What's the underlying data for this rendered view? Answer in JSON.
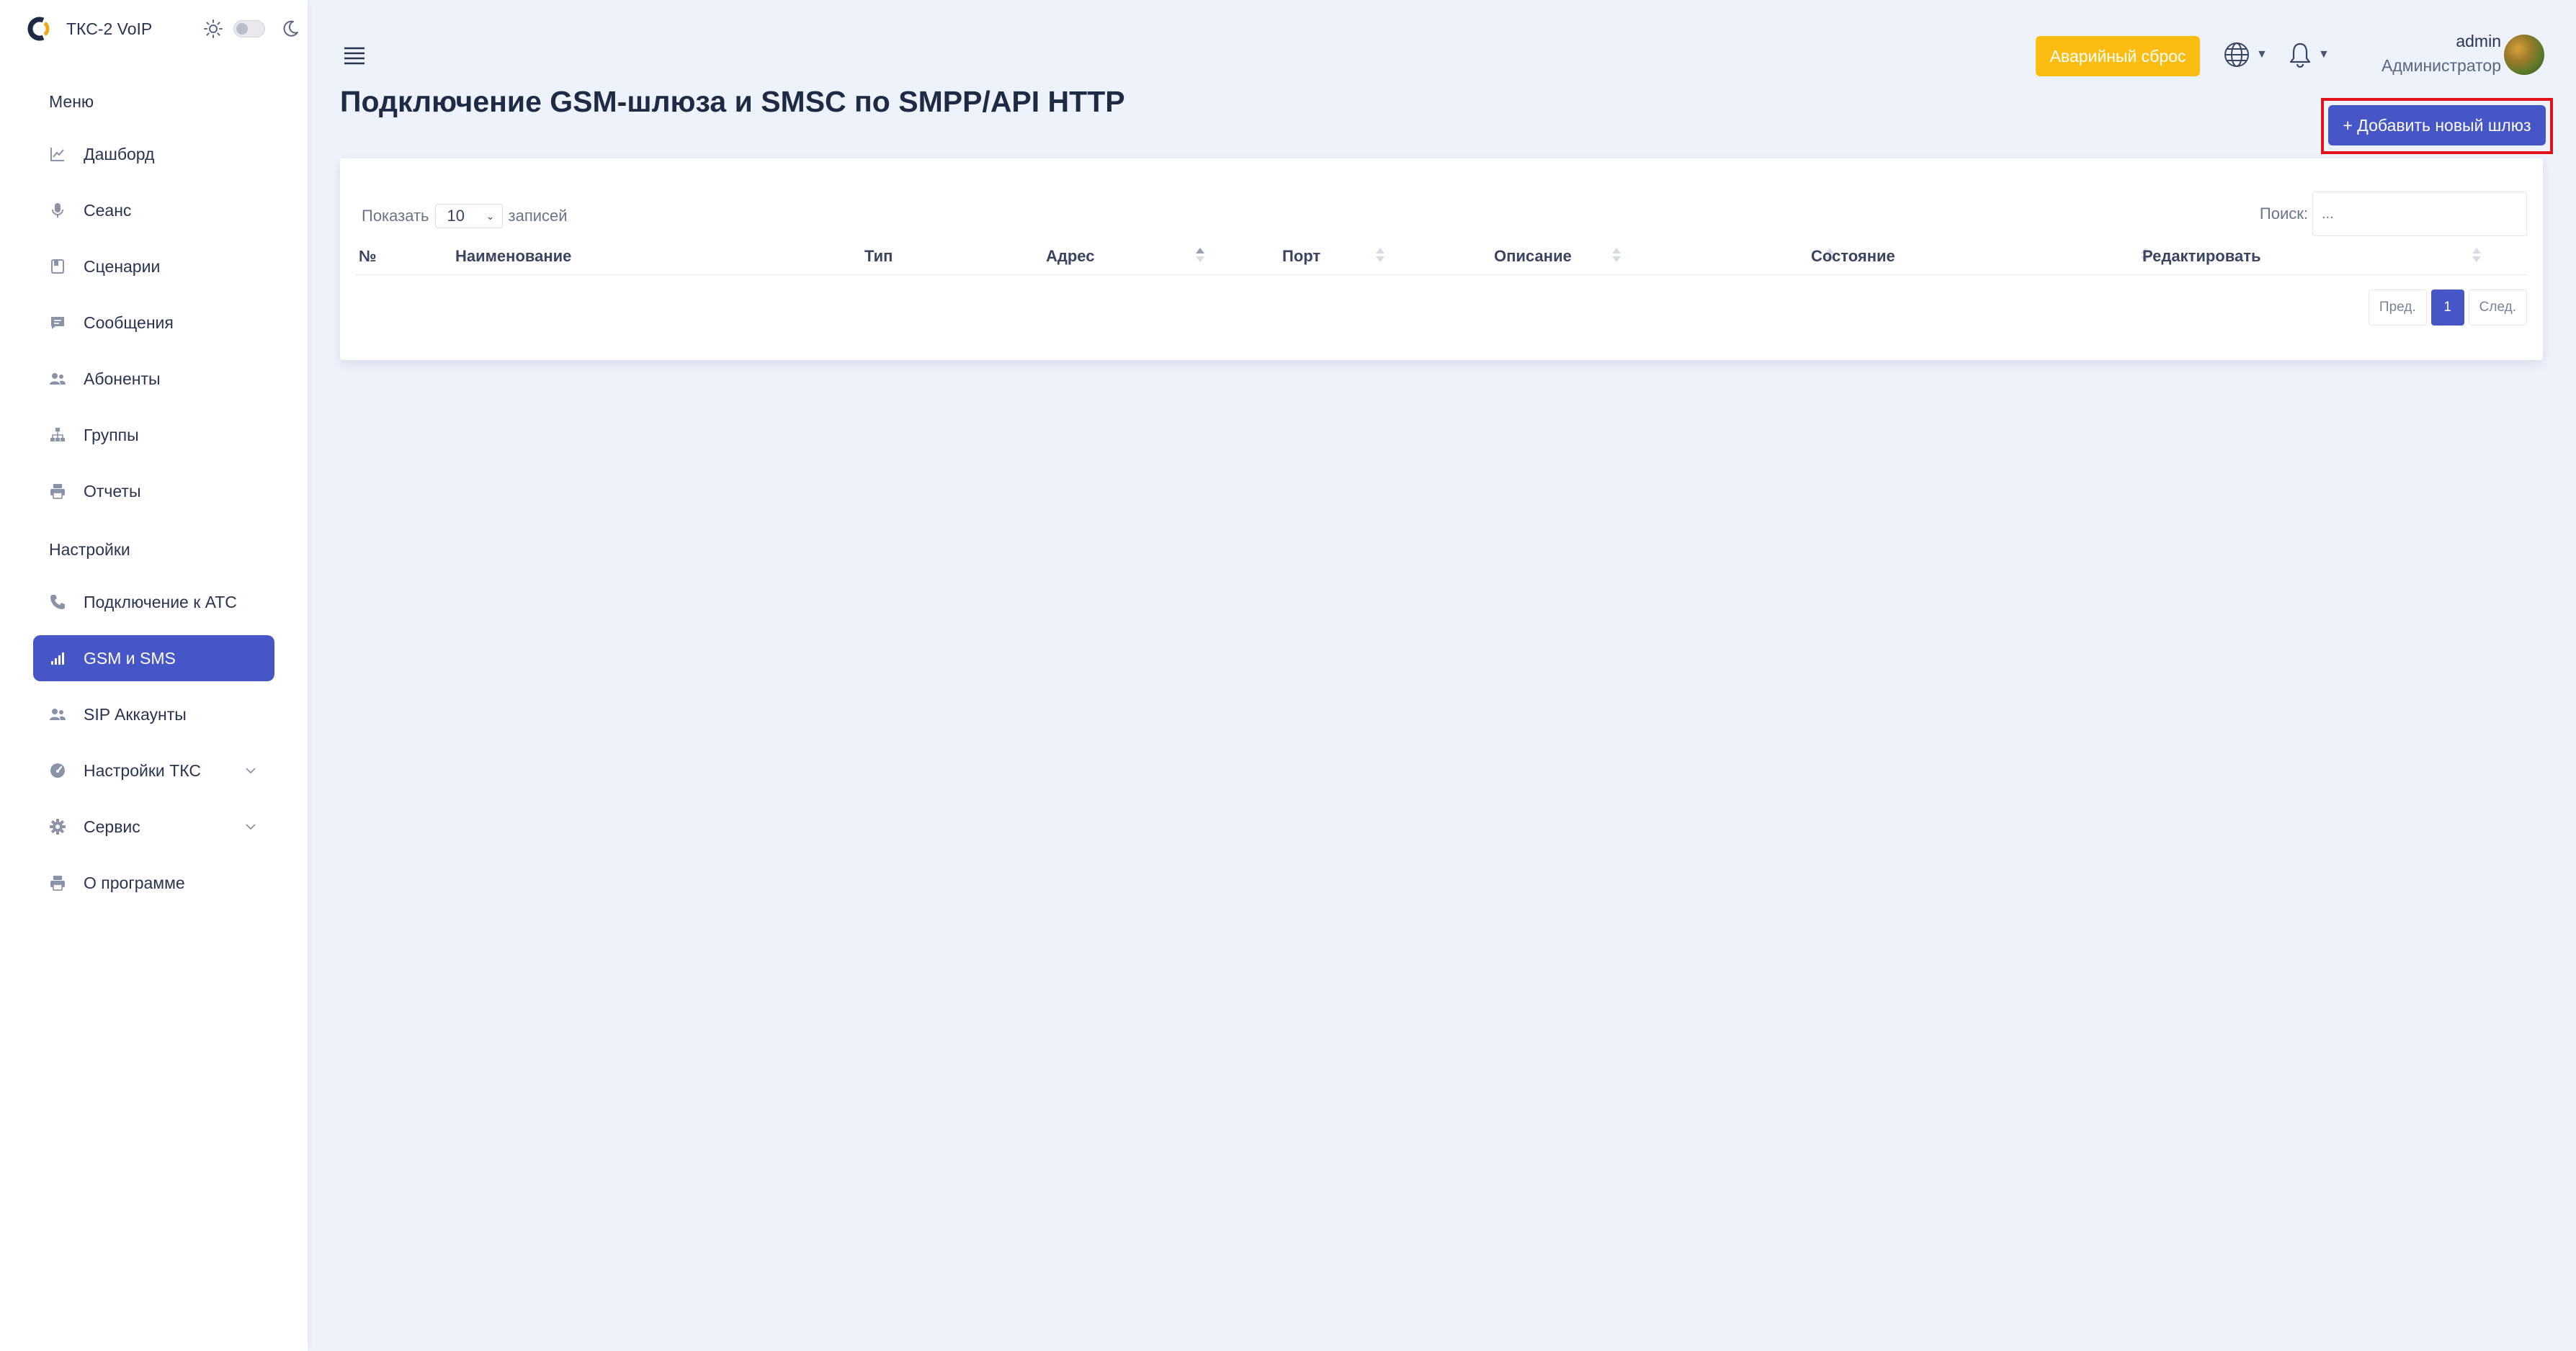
{
  "app": {
    "name": "ТКС-2 VoIP"
  },
  "sidebar": {
    "menu_title": "Меню",
    "menu": [
      {
        "label": "Дашборд",
        "icon": "chart-line-icon"
      },
      {
        "label": "Сеанс",
        "icon": "microphone-icon"
      },
      {
        "label": "Сценарии",
        "icon": "book-icon"
      },
      {
        "label": "Сообщения",
        "icon": "message-icon"
      },
      {
        "label": "Абоненты",
        "icon": "users-icon"
      },
      {
        "label": "Группы",
        "icon": "sitemap-icon"
      },
      {
        "label": "Отчеты",
        "icon": "printer-icon"
      }
    ],
    "settings_title": "Настройки",
    "settings": [
      {
        "label": "Подключение к АТС",
        "icon": "phone-icon"
      },
      {
        "label": "GSM и SMS",
        "icon": "signal-icon",
        "active": true
      },
      {
        "label": "SIP Аккаунты",
        "icon": "users-icon"
      },
      {
        "label": "Настройки ТКС",
        "icon": "gauge-icon",
        "expandable": true
      },
      {
        "label": "Сервис",
        "icon": "gear-icon",
        "expandable": true
      },
      {
        "label": "О программе",
        "icon": "printer-icon"
      }
    ]
  },
  "header": {
    "emergency_label": "Аварийный сброс",
    "user_name": "admin",
    "user_role": "Администратор"
  },
  "page": {
    "title": "Подключение GSM-шлюза и SMSC по SMPP/API HTTP",
    "add_button": "+ Добавить новый шлюз"
  },
  "table": {
    "show_label": "Показать",
    "page_size": "10",
    "entries_label": "записей",
    "search_label": "Поиск:",
    "search_placeholder": "...",
    "columns": [
      "№",
      "Наименование",
      "Тип",
      "Адрес",
      "Порт",
      "Описание",
      "Состояние",
      "Редактировать"
    ],
    "rows": [],
    "pagination": {
      "prev": "Пред.",
      "current": "1",
      "next": "След."
    }
  },
  "colors": {
    "accent": "#4656c6",
    "warning": "#fbbd11",
    "highlight_frame": "#e0121c",
    "background": "#eef2fb"
  }
}
